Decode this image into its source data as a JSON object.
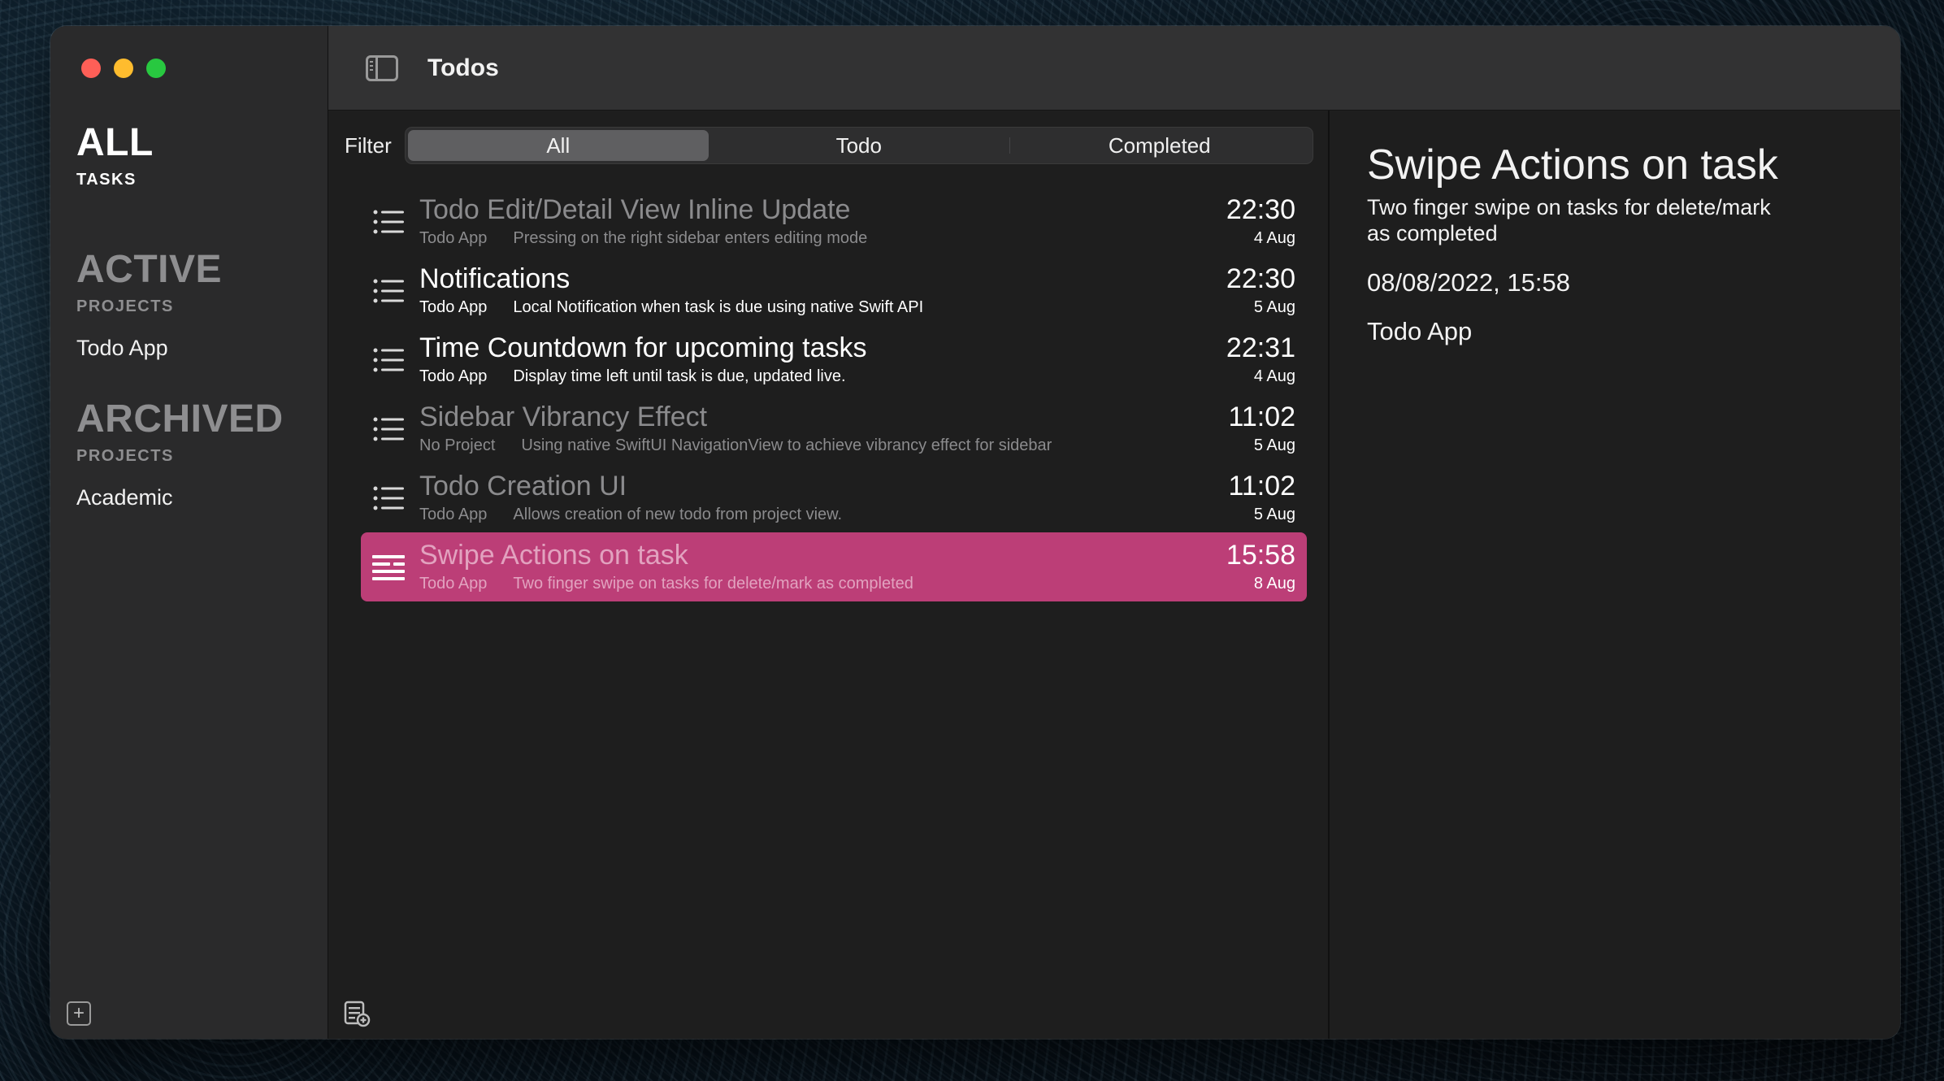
{
  "window": {
    "title": "Todos"
  },
  "sidebar": {
    "all": {
      "heading": "ALL",
      "sub": "TASKS"
    },
    "active": {
      "heading": "ACTIVE",
      "sub": "PROJECTS",
      "items": [
        {
          "label": "Todo App"
        }
      ]
    },
    "archived": {
      "heading": "ARCHIVED",
      "sub": "PROJECTS",
      "items": [
        {
          "label": "Academic"
        }
      ]
    },
    "add_icon": "plus-square-icon"
  },
  "filter": {
    "label": "Filter",
    "options": [
      "All",
      "Todo",
      "Completed"
    ],
    "selected": "All"
  },
  "todos": [
    {
      "title": "Todo Edit/Detail View Inline Update",
      "project": "Todo App",
      "description": "Pressing on the right sidebar enters editing mode",
      "time": "22:30",
      "date": "4 Aug",
      "state": "completed"
    },
    {
      "title": "Notifications",
      "project": "Todo App",
      "description": "Local Notification when task is due using native Swift API",
      "time": "22:30",
      "date": "5 Aug",
      "state": "todo"
    },
    {
      "title": "Time Countdown for upcoming tasks",
      "project": "Todo App",
      "description": "Display time left until task is due, updated live.",
      "time": "22:31",
      "date": "4 Aug",
      "state": "todo"
    },
    {
      "title": "Sidebar Vibrancy Effect",
      "project": "No Project",
      "description": "Using native SwiftUI NavigationView to achieve vibrancy effect for sidebar",
      "time": "11:02",
      "date": "5 Aug",
      "state": "completed"
    },
    {
      "title": "Todo Creation UI",
      "project": "Todo App",
      "description": "Allows creation of new todo from project view.",
      "time": "11:02",
      "date": "5 Aug",
      "state": "completed"
    },
    {
      "title": "Swipe Actions on task",
      "project": "Todo App",
      "description": "Two finger swipe on tasks for delete/mark as completed",
      "time": "15:58",
      "date": "8 Aug",
      "state": "selected"
    }
  ],
  "detail": {
    "title": "Swipe Actions on task",
    "description": "Two finger swipe on tasks for delete/mark as completed",
    "due": "08/08/2022, 15:58",
    "project": "Todo App"
  },
  "colors": {
    "selection": "#bc3e77",
    "close": "#fe5f57",
    "minimize": "#febc2e",
    "zoom": "#28c840"
  }
}
